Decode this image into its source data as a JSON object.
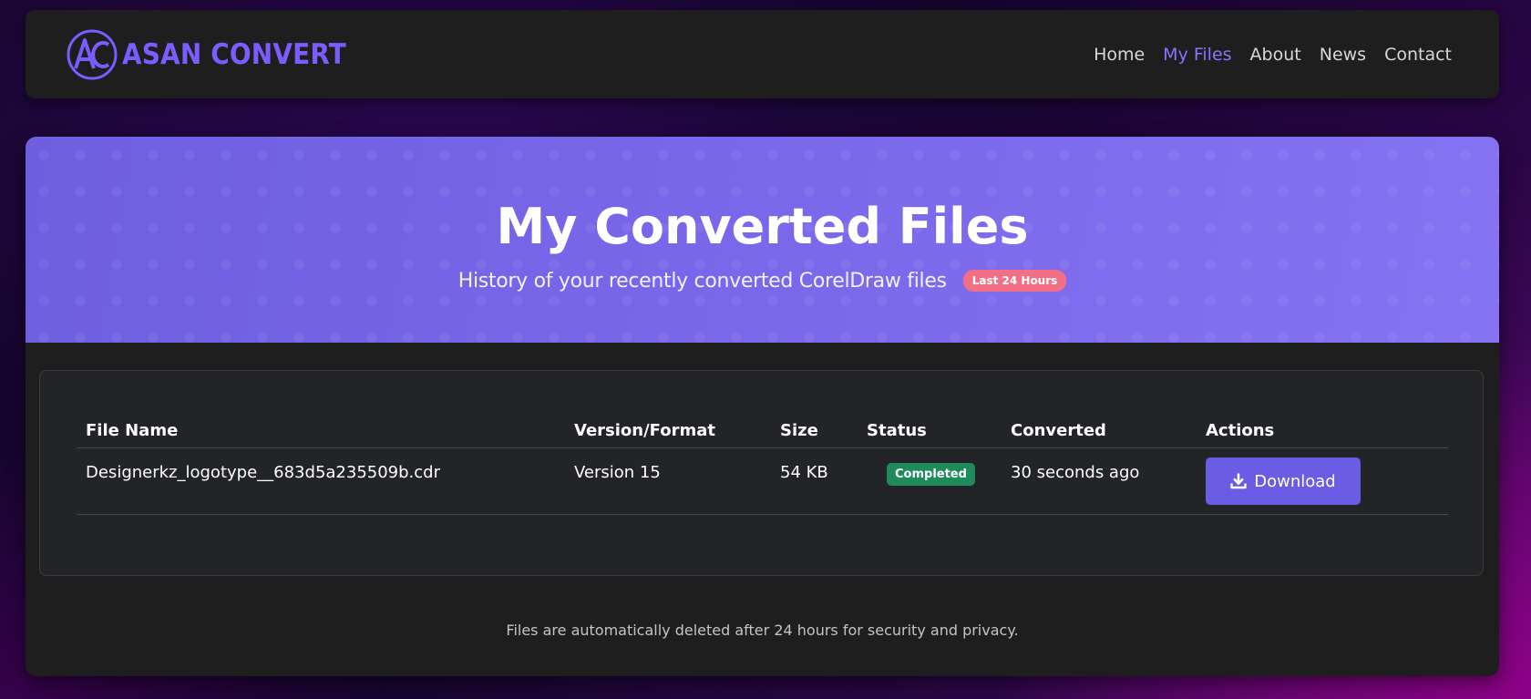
{
  "brand": {
    "name": "ASAN CONVERT",
    "logo_icon": "ac-monogram-icon",
    "accent_color": "#7b5cff"
  },
  "nav": {
    "items": [
      {
        "label": "Home",
        "active": false
      },
      {
        "label": "My Files",
        "active": true
      },
      {
        "label": "About",
        "active": false
      },
      {
        "label": "News",
        "active": false
      },
      {
        "label": "Contact",
        "active": false
      }
    ]
  },
  "hero": {
    "title": "My Converted Files",
    "subtitle": "History of your recently converted CorelDraw files",
    "badge": "Last 24 Hours",
    "badge_color": "#f36f86",
    "background_color": "#7a68ea"
  },
  "table": {
    "columns": [
      "File Name",
      "Version/Format",
      "Size",
      "Status",
      "Converted",
      "Actions"
    ],
    "rows": [
      {
        "file_name": "Designerkz_logotype__683d5a235509b.cdr",
        "version": "Version 15",
        "size": "54 KB",
        "status": "Completed",
        "converted": "30 seconds ago",
        "action_label": "Download",
        "action_icon": "download-icon"
      }
    ],
    "status_color": "#1f8a5a",
    "button_color": "#6b5ce4"
  },
  "footer": {
    "note": "Files are automatically deleted after 24 hours for security and privacy."
  }
}
